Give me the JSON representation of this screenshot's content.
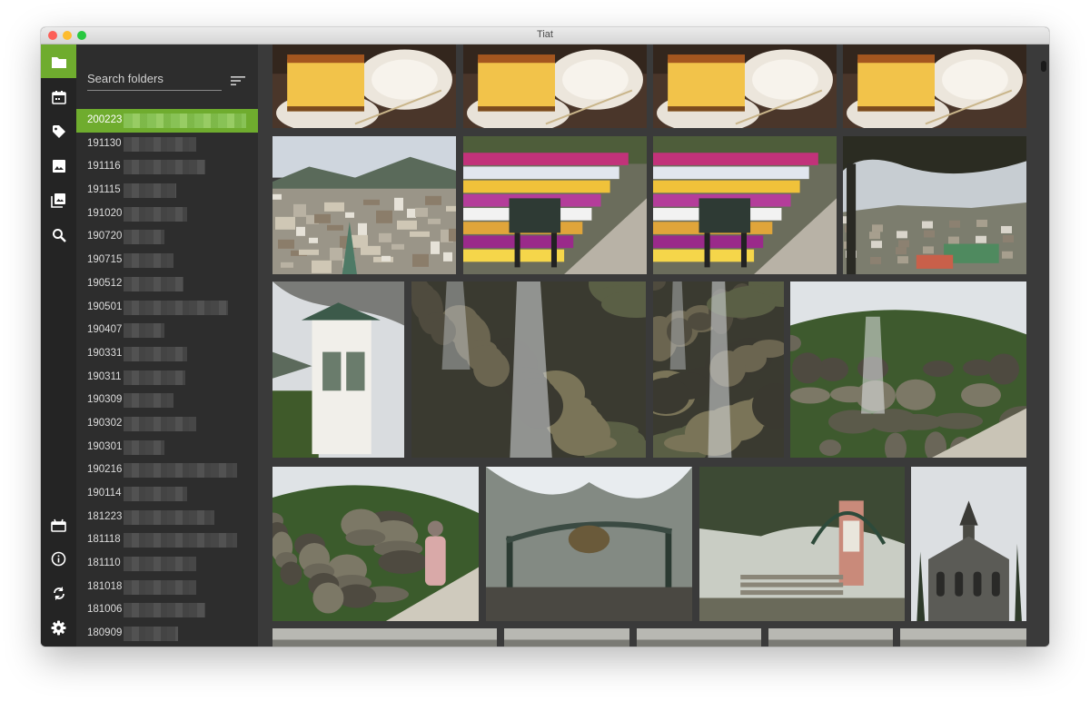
{
  "window": {
    "title": "Tiat"
  },
  "sidebar_icons": [
    {
      "name": "folder-icon",
      "active": true
    },
    {
      "name": "calendar-icon",
      "active": false
    },
    {
      "name": "tag-icon",
      "active": false
    },
    {
      "name": "image-icon",
      "active": false
    },
    {
      "name": "album-icon",
      "active": false
    },
    {
      "name": "search-icon",
      "active": false
    },
    {
      "name": "package-icon",
      "active": false
    },
    {
      "name": "info-icon",
      "active": false
    },
    {
      "name": "sync-icon",
      "active": false
    },
    {
      "name": "settings-icon",
      "active": false
    }
  ],
  "search": {
    "placeholder": "Search folders"
  },
  "folders": [
    {
      "label": "200223",
      "selected": true
    },
    {
      "label": "191130"
    },
    {
      "label": "191116"
    },
    {
      "label": "191115"
    },
    {
      "label": "191020"
    },
    {
      "label": "190720"
    },
    {
      "label": "190715"
    },
    {
      "label": "190512"
    },
    {
      "label": "190501"
    },
    {
      "label": "190407"
    },
    {
      "label": "190331"
    },
    {
      "label": "190311"
    },
    {
      "label": "190309"
    },
    {
      "label": "190302"
    },
    {
      "label": "190301"
    },
    {
      "label": "190216"
    },
    {
      "label": "190114"
    },
    {
      "label": "181223"
    },
    {
      "label": "181118"
    },
    {
      "label": "181110"
    },
    {
      "label": "181018"
    },
    {
      "label": "181006"
    },
    {
      "label": "180909"
    }
  ],
  "photos": [
    {
      "subject": "castella-cake"
    },
    {
      "subject": "castella-cake"
    },
    {
      "subject": "castella-cake"
    },
    {
      "subject": "castella-cake"
    },
    {
      "subject": "city-view"
    },
    {
      "subject": "flower-garden-bench"
    },
    {
      "subject": "flower-garden-bench"
    },
    {
      "subject": "tree-city-view"
    },
    {
      "subject": "white-booth"
    },
    {
      "subject": "waterfall-rocks"
    },
    {
      "subject": "waterfall-rocks"
    },
    {
      "subject": "garden-waterfall"
    },
    {
      "subject": "garden-waterfall-person"
    },
    {
      "subject": "glover-garden-gate"
    },
    {
      "subject": "garden-monument"
    },
    {
      "subject": "church"
    },
    {
      "subject": "partial"
    },
    {
      "subject": "partial"
    },
    {
      "subject": "partial"
    },
    {
      "subject": "partial"
    },
    {
      "subject": "partial"
    }
  ],
  "colors": {
    "accent": "#6fac2e",
    "sidebar": "#242424",
    "folder_pane": "#2d2d2d",
    "gallery_bg": "#3a3a3a"
  }
}
